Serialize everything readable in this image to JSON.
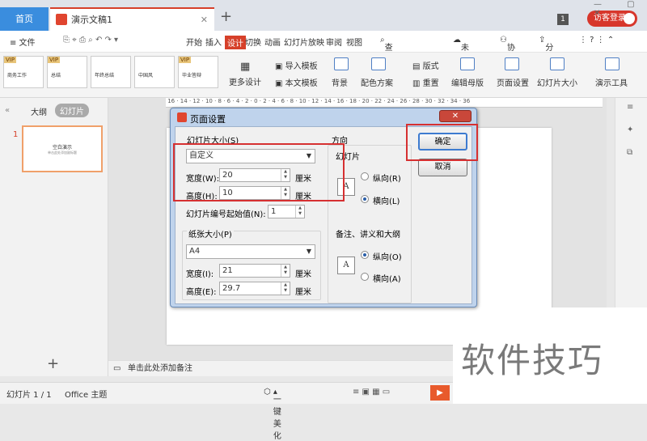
{
  "titlebar": {
    "home_tab": "首页",
    "doc_tab": "演示文稿1",
    "add_tab": "+",
    "num_badge": "1",
    "login": "访客登录"
  },
  "menubar": {
    "file": "≡ 文件",
    "tabs": [
      "开始",
      "插入",
      "设计",
      "切换",
      "动画",
      "幻灯片放映",
      "审阅",
      "视图"
    ],
    "search": "查找命令...",
    "unsaved": "未保存",
    "collab": "协作",
    "share": "分享"
  },
  "ribbon": {
    "templates": [
      {
        "vip": "VIP",
        "text": "商务工作"
      },
      {
        "vip": "VIP",
        "text": "总结"
      },
      {
        "vip": "",
        "text": "年终总结"
      },
      {
        "vip": "",
        "text": "中国风"
      },
      {
        "vip": "VIP",
        "text": "毕业答辩"
      }
    ],
    "more_design": "更多设计",
    "import_template": "导入模板",
    "text_template": "本文模板",
    "background": "背景",
    "color_scheme": "配色方案",
    "layout": "版式",
    "reset": "重置",
    "edit_master": "编辑母版",
    "page_setup": "页面设置",
    "slide_size": "幻灯片大小",
    "presentation_tools": "演示工具"
  },
  "left_panel": {
    "tab_outline": "大纲",
    "tab_slides": "幻灯片",
    "slide_number": "1",
    "slide_title": "空白演示",
    "slide_sub": "单击此处添加副标题",
    "add_slide": "+"
  },
  "notes": "单击此处添加备注",
  "statusbar": {
    "slide_count": "幻灯片 1 / 1",
    "theme": "Office 主题",
    "beautify": "一键美化"
  },
  "watermark": "软件技巧",
  "dialog": {
    "title": "页面设置",
    "close": "✕",
    "slide_size_label": "幻灯片大小(S)",
    "slide_size_value": "自定义",
    "width_label": "宽度(W):",
    "width_value": "20",
    "height_label": "高度(H):",
    "height_value": "10",
    "unit": "厘米",
    "start_number_label": "幻灯片编号起始值(N):",
    "start_number_value": "1",
    "paper_size_label": "纸张大小(P)",
    "paper_size_value": "A4",
    "paper_width_label": "宽度(I):",
    "paper_width_value": "21",
    "paper_height_label": "高度(E):",
    "paper_height_value": "29.7",
    "orientation_label": "方向",
    "slides_label": "幻灯片",
    "portrait_label": "纵向(R)",
    "landscape_label": "横向(L)",
    "notes_label": "备注、讲义和大纲",
    "notes_portrait_label": "纵向(O)",
    "notes_landscape_label": "横向(A)",
    "ok": "确定",
    "cancel": "取消"
  }
}
